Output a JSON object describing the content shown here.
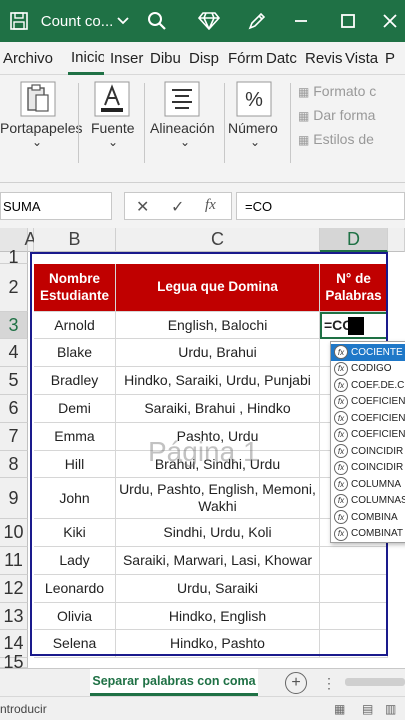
{
  "titlebar": {
    "save_icon": "save-icon",
    "undo_icon": "undo-icon",
    "file_name": "Count co...",
    "dropdown_icon": "chevron-down-icon",
    "search_icon": "search-icon",
    "gem_icon": "diamond-icon",
    "brush_icon": "pen-icon",
    "minimize_icon": "minimize-icon",
    "restore_icon": "restore-icon",
    "close_icon": "close-icon"
  },
  "ribbon_tabs": [
    "Archivo",
    "Inicio",
    "Inser",
    "Dibu",
    "Disp",
    "Fórm",
    "Datc",
    "Revis",
    "Vista",
    "P"
  ],
  "ribbon": {
    "portapapeles": "Portapapeles",
    "fuente": "Fuente",
    "alineacion": "Alineación",
    "numero": "Número",
    "formato": "Formato c",
    "dar_formato": "Dar forma",
    "estilos": "Estilos de"
  },
  "formula_bar": {
    "name_box": "SUMA",
    "formula": "=CO"
  },
  "columns": [
    "A",
    "B",
    "C",
    "D"
  ],
  "rows": [
    "1",
    "2",
    "3",
    "4",
    "5",
    "6",
    "7",
    "8",
    "9",
    "10",
    "11",
    "12",
    "13",
    "14",
    "15"
  ],
  "table": {
    "headers": [
      "Nombre Estudiante",
      "Legua que Domina",
      "N° de Palabras"
    ],
    "rows": [
      [
        "Arnold",
        "English, Balochi",
        "=CO"
      ],
      [
        "Blake",
        "Urdu, Brahui",
        ""
      ],
      [
        "Bradley",
        "Hindko, Saraiki, Urdu, Punjabi",
        ""
      ],
      [
        "Demi",
        "Saraiki, Brahui , Hindko",
        ""
      ],
      [
        "Emma",
        "Pashto, Urdu",
        ""
      ],
      [
        "Hill",
        "Brahui, Sindhi, Urdu",
        ""
      ],
      [
        "John",
        "Urdu, Pashto, English, Memoni, Wakhi",
        ""
      ],
      [
        "Kiki",
        "Sindhi, Urdu, Koli",
        ""
      ],
      [
        "Lady",
        "Saraiki, Marwari, Lasi, Khowar",
        ""
      ],
      [
        "Leonardo",
        "Urdu, Saraiki",
        ""
      ],
      [
        "Olivia",
        "Hindko, English",
        ""
      ],
      [
        "Selena",
        "Hindko, Pashto",
        ""
      ]
    ]
  },
  "watermark": "Página 1",
  "autocomplete": [
    "COCIENTE",
    "CODIGO",
    "COEF.DE.C",
    "COEFICIEN",
    "COEFICIEN",
    "COEFICIEN",
    "COINCIDIR",
    "COINCIDIR",
    "COLUMNA",
    "COLUMNAS",
    "COMBINA",
    "COMBINAT"
  ],
  "sheet_tab": "Separar palabras con coma",
  "status": "ntroducir",
  "colors": {
    "excel_green": "#1f7145",
    "header_red": "#c00000",
    "table_border": "#1a1a8c",
    "selection": "#1f78c8"
  }
}
